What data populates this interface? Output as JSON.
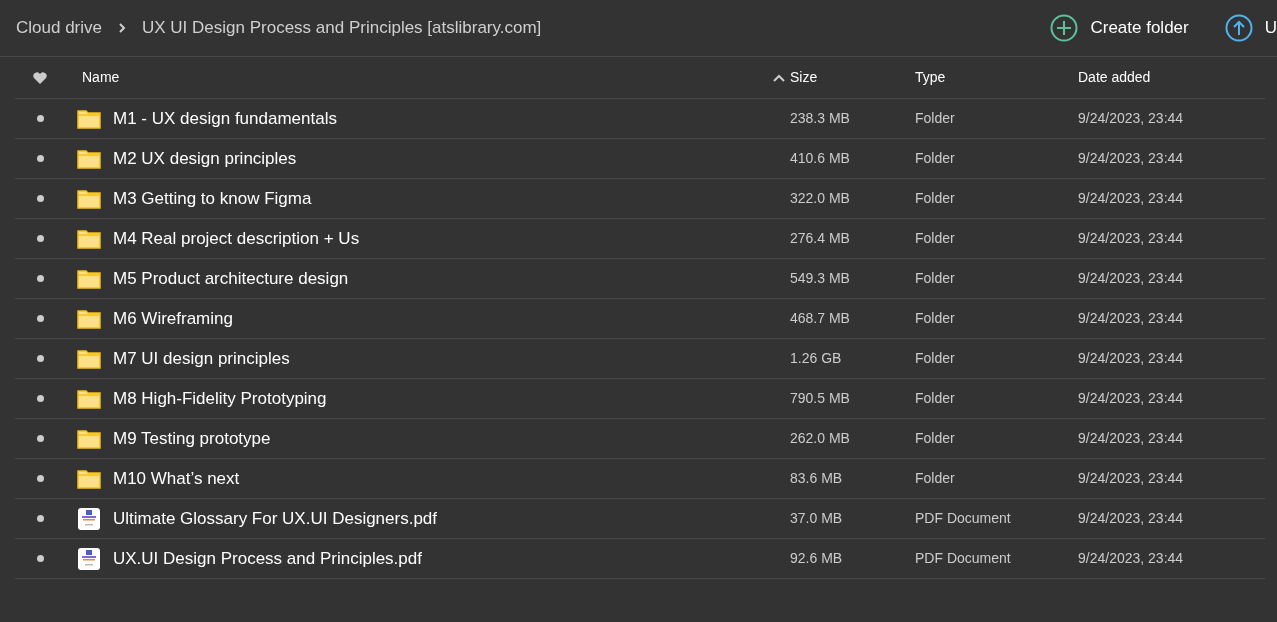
{
  "breadcrumb": [
    "Cloud drive",
    "UX UI Design Process and Principles [atslibrary.com]"
  ],
  "actions": [
    {
      "kind": "create",
      "label": "Create folder"
    },
    {
      "kind": "upload",
      "label": "U"
    }
  ],
  "columns": {
    "name": "Name",
    "size": "Size",
    "type": "Type",
    "date": "Date added"
  },
  "rows": [
    {
      "kind": "folder",
      "name": "M1 - UX design fundamentals",
      "size": "238.3 MB",
      "type": "Folder",
      "date": "9/24/2023, 23:44"
    },
    {
      "kind": "folder",
      "name": "M2 UX design principles",
      "size": "410.6 MB",
      "type": "Folder",
      "date": "9/24/2023, 23:44"
    },
    {
      "kind": "folder",
      "name": "M3 Getting to know Figma",
      "size": "322.0 MB",
      "type": "Folder",
      "date": "9/24/2023, 23:44"
    },
    {
      "kind": "folder",
      "name": "M4 Real project description + Us",
      "size": "276.4 MB",
      "type": "Folder",
      "date": "9/24/2023, 23:44"
    },
    {
      "kind": "folder",
      "name": "M5 Product architecture design",
      "size": "549.3 MB",
      "type": "Folder",
      "date": "9/24/2023, 23:44"
    },
    {
      "kind": "folder",
      "name": "M6 Wireframing",
      "size": "468.7 MB",
      "type": "Folder",
      "date": "9/24/2023, 23:44"
    },
    {
      "kind": "folder",
      "name": "M7 UI design principles",
      "size": "1.26 GB",
      "type": "Folder",
      "date": "9/24/2023, 23:44"
    },
    {
      "kind": "folder",
      "name": "M8 High-Fidelity Prototyping",
      "size": "790.5 MB",
      "type": "Folder",
      "date": "9/24/2023, 23:44"
    },
    {
      "kind": "folder",
      "name": "M9 Testing prototype",
      "size": "262.0 MB",
      "type": "Folder",
      "date": "9/24/2023, 23:44"
    },
    {
      "kind": "folder",
      "name": "M10 What’s next",
      "size": "83.6 MB",
      "type": "Folder",
      "date": "9/24/2023, 23:44"
    },
    {
      "kind": "pdf",
      "name": "Ultimate Glossary For UX.UI Designers.pdf",
      "size": "37.0 MB",
      "type": "PDF Document",
      "date": "9/24/2023, 23:44"
    },
    {
      "kind": "pdf",
      "name": "UX.UI Design Process and Principles.pdf",
      "size": "92.6 MB",
      "type": "PDF Document",
      "date": "9/24/2023, 23:44"
    }
  ]
}
